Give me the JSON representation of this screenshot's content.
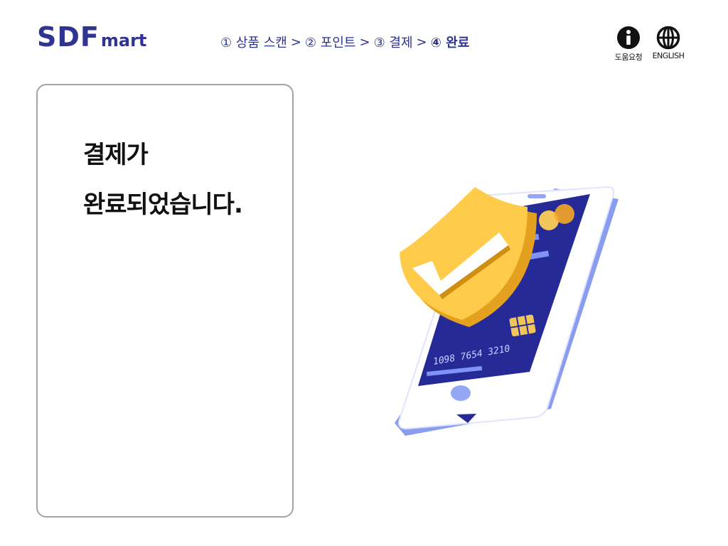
{
  "header": {
    "logo_main": "SDF",
    "logo_sub": "mart",
    "steps": [
      {
        "label": "① 상품 스캔"
      },
      {
        "label": "② 포인트"
      },
      {
        "label": "③ 결제"
      },
      {
        "label": "④ 완료"
      }
    ],
    "step_separator": ">",
    "active_step": 4,
    "help_label": "도움요청",
    "english_label": "ENGLISH"
  },
  "main": {
    "message_line1": "결제가",
    "message_line2": "완료되었습니다."
  },
  "illustration": {
    "card_number": "1098 7654 3210",
    "icon": "shield-check-phone-icon"
  },
  "colors": {
    "brand": "#2f3491",
    "panel_border": "#a4a4a4",
    "shield": "#ffcb4a",
    "phone_frame": "#95a6f5",
    "card": "#252a97"
  }
}
